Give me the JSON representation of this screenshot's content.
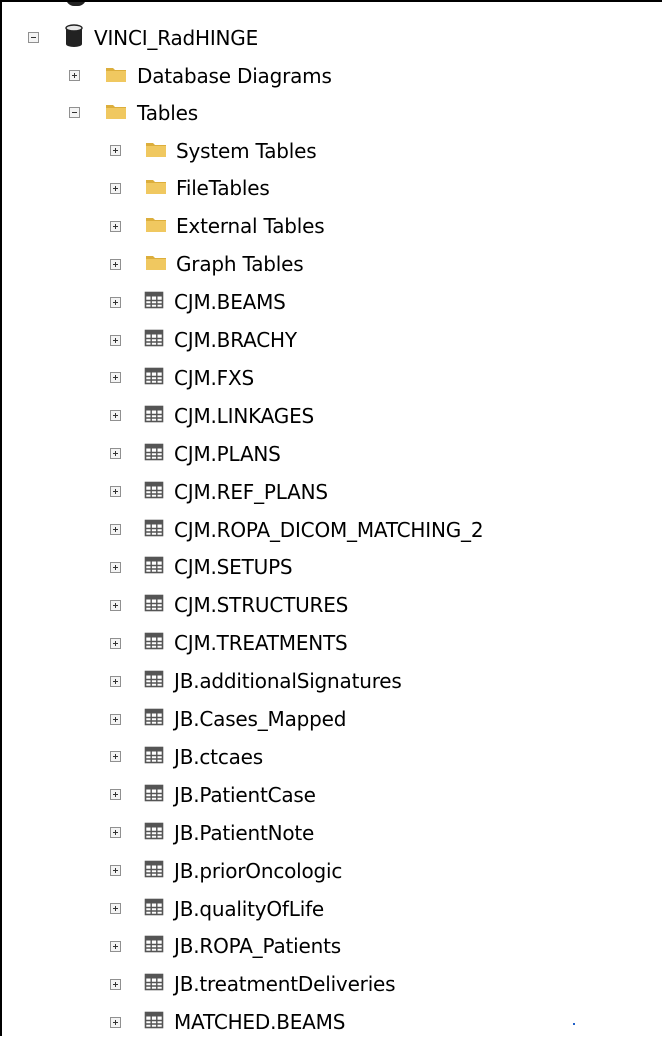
{
  "tree": {
    "database": {
      "label": "VINCI_RadHINGE",
      "icon": "database-icon",
      "expanded": true
    },
    "folders_top": [
      {
        "label": "Database Diagrams",
        "icon": "folder-icon",
        "expanded": false
      },
      {
        "label": "Tables",
        "icon": "folder-icon",
        "expanded": true
      }
    ],
    "table_folders": [
      {
        "label": "System Tables",
        "icon": "folder-icon"
      },
      {
        "label": "FileTables",
        "icon": "folder-icon"
      },
      {
        "label": "External Tables",
        "icon": "folder-icon"
      },
      {
        "label": "Graph Tables",
        "icon": "folder-icon"
      }
    ],
    "tables": [
      {
        "label": "CJM.BEAMS"
      },
      {
        "label": "CJM.BRACHY"
      },
      {
        "label": "CJM.FXS"
      },
      {
        "label": "CJM.LINKAGES"
      },
      {
        "label": "CJM.PLANS"
      },
      {
        "label": "CJM.REF_PLANS"
      },
      {
        "label": "CJM.ROPA_DICOM_MATCHING_2"
      },
      {
        "label": "CJM.SETUPS"
      },
      {
        "label": "CJM.STRUCTURES"
      },
      {
        "label": "CJM.TREATMENTS"
      },
      {
        "label": "JB.additionalSignatures"
      },
      {
        "label": "JB.Cases_Mapped"
      },
      {
        "label": "JB.ctcaes"
      },
      {
        "label": "JB.PatientCase"
      },
      {
        "label": "JB.PatientNote"
      },
      {
        "label": "JB.priorOncologic"
      },
      {
        "label": "JB.qualityOfLife"
      },
      {
        "label": "JB.ROPA_Patients"
      },
      {
        "label": "JB.treatmentDeliveries"
      },
      {
        "label": "MATCHED.BEAMS"
      }
    ],
    "colors": {
      "folder": "#f0c860",
      "folder_dark": "#dcae3c",
      "table_icon": "#555555",
      "db_icon": "#222222"
    }
  }
}
